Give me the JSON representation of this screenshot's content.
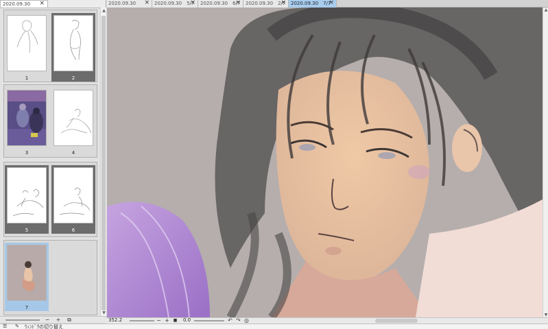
{
  "page_panel": {
    "tab_title": "2020.09.30",
    "pages": [
      {
        "number": "1",
        "state": "normal"
      },
      {
        "number": "2",
        "state": "selected"
      },
      {
        "number": "3",
        "state": "normal"
      },
      {
        "number": "4",
        "state": "normal"
      },
      {
        "number": "5",
        "state": "selected"
      },
      {
        "number": "6",
        "state": "selected"
      },
      {
        "number": "7",
        "state": "current"
      }
    ],
    "footer": {
      "minus": "−",
      "plus": "+",
      "options": "⧉"
    }
  },
  "doc_tabs": [
    {
      "label": "2020.09.30",
      "close": "×",
      "active": false
    },
    {
      "label": "2020.09.30　5/7",
      "close": "×",
      "active": false
    },
    {
      "label": "2020.09.30　6/7",
      "close": "×",
      "active": false
    },
    {
      "label": "2020.09.30　2/7",
      "close": "×",
      "active": false
    },
    {
      "label": "2020.09.30　7/7",
      "close": "×",
      "active": true
    }
  ],
  "status": {
    "zoom_value": "352.2",
    "zoom_minus": "−",
    "zoom_plus": "+",
    "zoom_stop": "■",
    "rotation_value": "0.0",
    "rotate_left": "↶",
    "rotate_right": "↷",
    "rotate_reset": "◎"
  },
  "taskbar": {
    "label": "ｳｨﾝﾄﾞｳの切り替え"
  },
  "colors": {
    "active_tab": "#a8ccec",
    "selected_page": "#6c6c6c",
    "current_page": "#a6c8e8",
    "canvas_background": "#b5aeac"
  }
}
